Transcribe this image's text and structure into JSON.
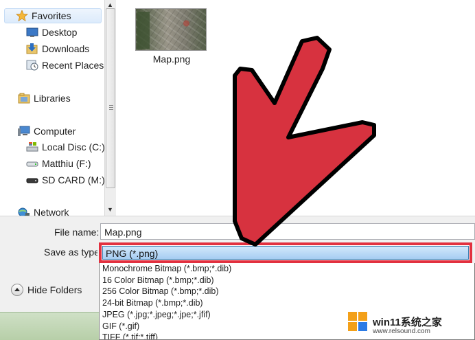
{
  "nav": {
    "favorites": {
      "label": "Favorites",
      "icon": "star-icon"
    },
    "desktop": {
      "label": "Desktop",
      "icon": "desktop-icon"
    },
    "downloads": {
      "label": "Downloads",
      "icon": "downloads-icon"
    },
    "recent_places": {
      "label": "Recent Places",
      "icon": "recent-places-icon"
    },
    "libraries": {
      "label": "Libraries",
      "icon": "libraries-icon"
    },
    "computer": {
      "label": "Computer",
      "icon": "computer-icon"
    },
    "local_disc": {
      "label": "Local Disc (C:)",
      "icon": "hard-drive-icon"
    },
    "matthiu": {
      "label": "Matthiu (F:)",
      "icon": "removable-drive-icon"
    },
    "sd_card": {
      "label": "SD CARD (M:)",
      "icon": "sd-card-icon"
    },
    "network": {
      "label": "Network",
      "icon": "network-icon"
    }
  },
  "files": [
    {
      "name": "Map.png",
      "thumbnail": "map-thumbnail"
    }
  ],
  "form": {
    "file_name_label": "File name:",
    "file_name_value": "Map.png",
    "save_type_label": "Save as type:",
    "save_type_value": "PNG (*.png)"
  },
  "hide_folders_label": "Hide Folders",
  "type_options": [
    "Monochrome Bitmap (*.bmp;*.dib)",
    "16 Color Bitmap (*.bmp;*.dib)",
    "256 Color Bitmap (*.bmp;*.dib)",
    "24-bit Bitmap (*.bmp;*.dib)",
    "JPEG (*.jpg;*.jpeg;*.jpe;*.jfif)",
    "GIF (*.gif)",
    "TIFF (*.tif;*.tiff)"
  ],
  "watermark": {
    "text": "win11系统之家",
    "sub": "www.relsound.com"
  },
  "colors": {
    "arrow_fill": "#d7323f",
    "highlight_border": "#e2303f",
    "selection_fill": "#b3d6f6"
  }
}
